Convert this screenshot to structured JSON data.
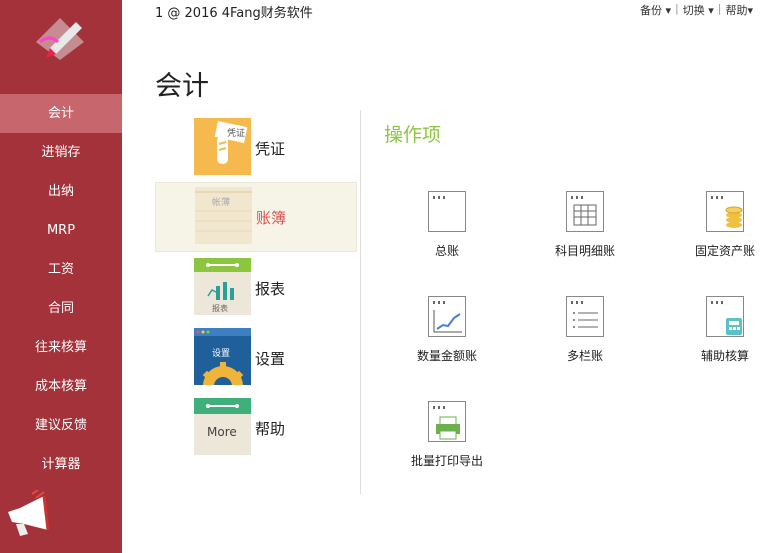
{
  "app": {
    "title": "1 @ 2016 4Fang财务软件"
  },
  "topmenu": {
    "backup": "备份",
    "switch": "切换",
    "help": "帮助"
  },
  "sidebar": {
    "items": [
      {
        "label": "会计"
      },
      {
        "label": "进销存"
      },
      {
        "label": "出纳"
      },
      {
        "label": "MRP"
      },
      {
        "label": "工资"
      },
      {
        "label": "合同"
      },
      {
        "label": "往来核算"
      },
      {
        "label": "成本核算"
      },
      {
        "label": "建议反馈"
      },
      {
        "label": "计算器"
      }
    ]
  },
  "page": {
    "title": "会计"
  },
  "categories": [
    {
      "label": "凭证",
      "icon_text": "凭证"
    },
    {
      "label": "账簿",
      "icon_text": "帐薄"
    },
    {
      "label": "报表",
      "icon_text": "报表"
    },
    {
      "label": "设置",
      "icon_text": "设置"
    },
    {
      "label": "帮助",
      "icon_text": "More"
    }
  ],
  "operations": {
    "title": "操作项",
    "items": [
      {
        "label": "总账"
      },
      {
        "label": "科目明细账"
      },
      {
        "label": "固定资产账"
      },
      {
        "label": "数量金额账"
      },
      {
        "label": "多栏账"
      },
      {
        "label": "辅助核算"
      },
      {
        "label": "批量打印导出"
      }
    ]
  },
  "colors": {
    "sidebar": "#a3323a",
    "sidebar_active": "#c7666c",
    "accent_green": "#8cc63f",
    "active_label": "#d9534f"
  }
}
